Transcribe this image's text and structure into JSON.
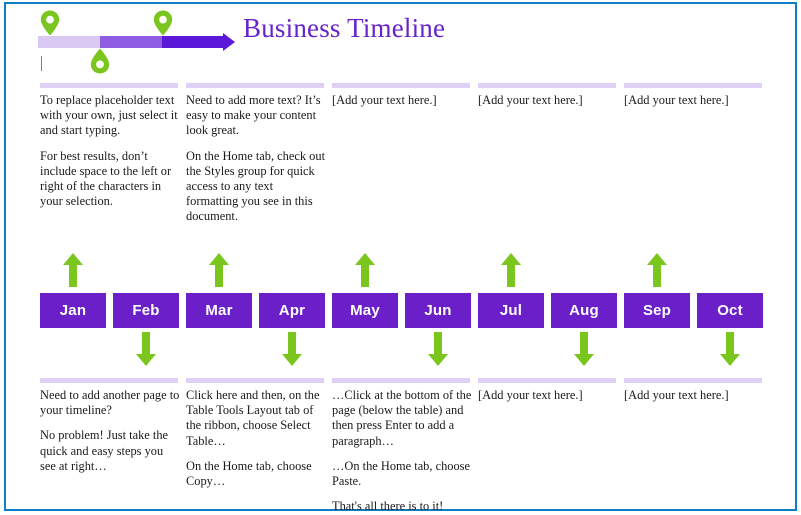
{
  "document": {
    "title": "Business Timeline",
    "title_color": "#6622cc",
    "page_border_color": "#0d7fc4"
  },
  "header": {
    "progress_bar": {
      "segments": [
        {
          "name": "segment-light",
          "color": "#d9c9f2"
        },
        {
          "name": "segment-medium",
          "color": "#8d5ce2"
        },
        {
          "name": "segment-dark",
          "color": "#5b18d9"
        }
      ],
      "arrow_color": "#5b18d9"
    },
    "markers": [
      {
        "name": "map-pin-icon",
        "orientation": "up",
        "color": "#7ac61e"
      },
      {
        "name": "map-pin-icon",
        "orientation": "up",
        "color": "#7ac61e"
      },
      {
        "name": "map-pin-icon",
        "orientation": "down",
        "color": "#7ac61e"
      }
    ]
  },
  "top_columns": [
    {
      "paragraphs": [
        "To replace placeholder text with your own, just select it and start typing.",
        "For best results, don’t include space to the left or right of the characters in your selection."
      ]
    },
    {
      "paragraphs": [
        "Need to add more text? It’s easy to make your content look great.",
        "On the Home tab, check out the Styles group for quick access to any text formatting you see in this document."
      ]
    },
    {
      "paragraphs": [
        "[Add your text here.]"
      ]
    },
    {
      "paragraphs": [
        "[Add your text here.]"
      ]
    },
    {
      "paragraphs": [
        "[Add your text here.]"
      ]
    }
  ],
  "timeline": {
    "box_color": "#6b1fc9",
    "box_text_color": "#ffffff",
    "arrow_color": "#7ac61e",
    "months": [
      {
        "label": "Jan",
        "arrow": "up"
      },
      {
        "label": "Feb",
        "arrow": "down"
      },
      {
        "label": "Mar",
        "arrow": "up"
      },
      {
        "label": "Apr",
        "arrow": "down"
      },
      {
        "label": "May",
        "arrow": "up"
      },
      {
        "label": "Jun",
        "arrow": "down"
      },
      {
        "label": "Jul",
        "arrow": "up"
      },
      {
        "label": "Aug",
        "arrow": "down"
      },
      {
        "label": "Sep",
        "arrow": "up"
      },
      {
        "label": "Oct",
        "arrow": "down"
      }
    ]
  },
  "bottom_columns": [
    {
      "paragraphs": [
        "Need to add another page to your timeline?",
        "No problem! Just take the quick and easy steps you see at right…"
      ]
    },
    {
      "paragraphs": [
        "Click here and then, on the Table Tools Layout tab of the ribbon, choose Select Table…",
        "On the Home tab, choose Copy…"
      ]
    },
    {
      "paragraphs": [
        "…Click at the bottom of the page (below the table) and then press Enter to add a paragraph…",
        "…On the Home tab, choose Paste.",
        "That's all there is to it!"
      ]
    },
    {
      "paragraphs": [
        "[Add your text here.]"
      ]
    },
    {
      "paragraphs": [
        "[Add your text here.]"
      ]
    }
  ]
}
